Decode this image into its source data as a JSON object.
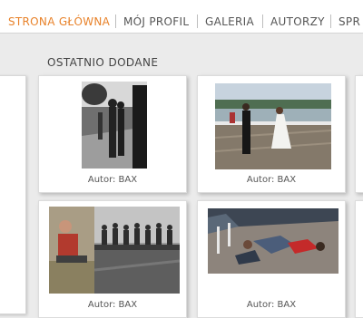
{
  "nav": {
    "items": [
      {
        "label": "STRONA GŁÓWNA",
        "active": true
      },
      {
        "label": "MÓJ PROFIL"
      },
      {
        "label": "GALERIA"
      },
      {
        "label": "AUTORZY"
      },
      {
        "label": "SPR"
      }
    ],
    "active_color": "#e8822a"
  },
  "section": {
    "title": "OSTATNIO DODANE"
  },
  "photos": [
    {
      "caption": "Autor: BAX",
      "subject": "black-and-white street photo"
    },
    {
      "caption": "Autor: BAX",
      "subject": "wedding couple dancing on pier"
    },
    {
      "caption": "Autor: BAX",
      "subject": "man sitting next to lunch atop skyscraper collage"
    },
    {
      "caption": "Autor: BAX",
      "subject": "people lying on cobblestones"
    }
  ]
}
